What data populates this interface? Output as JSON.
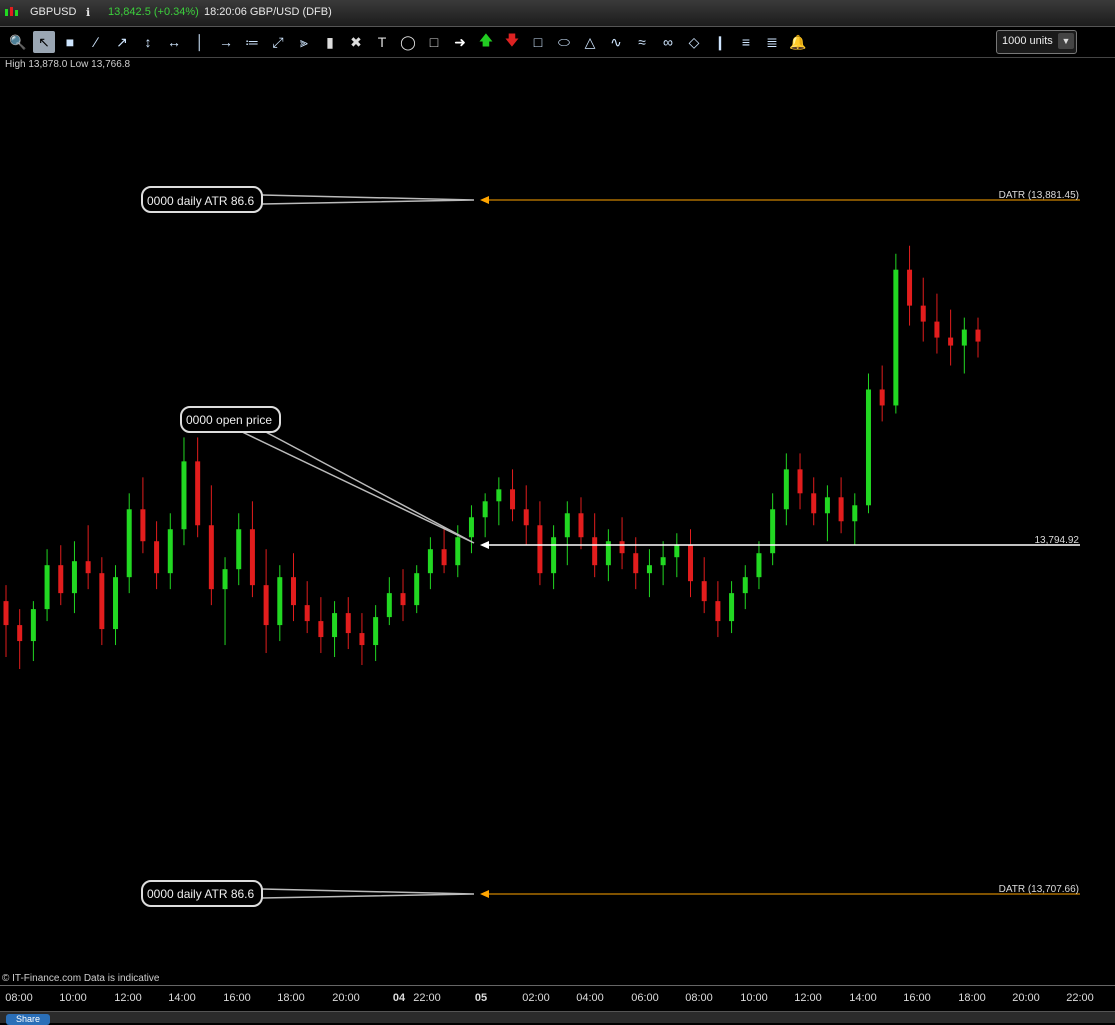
{
  "title_bar": {
    "symbol": "GBPUSD",
    "price_change": "13,842.5 (+0.34%)",
    "time_instrument": "18:20:06 GBP/USD (DFB)",
    "change_color": "#3ccf3c"
  },
  "toolbar": {
    "tools": [
      "magnifier-icon",
      "pointer-icon",
      "ruler-icon",
      "trendline-icon",
      "ray-icon",
      "vertical-line-icon",
      "channel-icon",
      "horizontal-line-icon",
      "horizontal-ray-icon",
      "parallel-channel-icon",
      "gann-icon",
      "pitchfork-icon",
      "delete-icon",
      "tools-icon",
      "text-icon",
      "callout-icon",
      "label-icon",
      "arrow-right-icon",
      "arrow-up-icon",
      "arrow-down-icon",
      "rectangle-icon",
      "ellipse-icon",
      "triangle-icon",
      "pattern-icon",
      "wave-icon",
      "cycles-icon",
      "diamond-icon",
      "fib-timezones-icon",
      "fib-retracement-icon",
      "fib-extension-icon",
      "alert-bell-icon"
    ],
    "units_value": "1000 units"
  },
  "chart_info": "High 13,878.0 Low 13,766.8",
  "annotations": {
    "upper_callout": "0000 daily ATR 86.6",
    "open_callout": "0000 open price",
    "lower_callout": "0000 daily ATR 86.6",
    "upper_line_label": "DATR (13,881.45)",
    "open_line_label": "13,794.92",
    "lower_line_label": "DATR (13,707.66)"
  },
  "footer_note": "© IT-Finance.com Data is indicative",
  "x_axis_ticks": [
    "08:00",
    "10:00",
    "12:00",
    "14:00",
    "16:00",
    "18:00",
    "20:00",
    "04",
    "22:00",
    "05",
    "02:00",
    "04:00",
    "06:00",
    "08:00",
    "10:00",
    "12:00",
    "14:00",
    "16:00",
    "18:00",
    "20:00",
    "22:00"
  ],
  "bottom_bar": {
    "share_label": "Share"
  },
  "colors": {
    "up": "#22d822",
    "down": "#e21d1d",
    "atr": "#ffa500",
    "open": "#ffffff"
  },
  "chart_data": {
    "type": "candlestick",
    "levels": {
      "atr_high": 13881.45,
      "open": 13794.92,
      "atr_low": 13707.66
    },
    "ylim": [
      13700,
      13900
    ],
    "ohlc": [
      [
        13781,
        13785,
        13767,
        13775
      ],
      [
        13775,
        13779,
        13764,
        13771
      ],
      [
        13771,
        13781,
        13766,
        13779
      ],
      [
        13779,
        13794,
        13776,
        13790
      ],
      [
        13790,
        13795,
        13780,
        13783
      ],
      [
        13783,
        13796,
        13778,
        13791
      ],
      [
        13791,
        13800,
        13784,
        13788
      ],
      [
        13788,
        13792,
        13770,
        13774
      ],
      [
        13774,
        13790,
        13770,
        13787
      ],
      [
        13787,
        13808,
        13783,
        13804
      ],
      [
        13804,
        13812,
        13793,
        13796
      ],
      [
        13796,
        13801,
        13784,
        13788
      ],
      [
        13788,
        13803,
        13784,
        13799
      ],
      [
        13799,
        13822,
        13795,
        13816
      ],
      [
        13816,
        13822,
        13797,
        13800
      ],
      [
        13800,
        13810,
        13780,
        13784
      ],
      [
        13784,
        13792,
        13770,
        13789
      ],
      [
        13789,
        13803,
        13785,
        13799
      ],
      [
        13799,
        13806,
        13782,
        13785
      ],
      [
        13785,
        13794,
        13768,
        13775
      ],
      [
        13775,
        13790,
        13771,
        13787
      ],
      [
        13787,
        13793,
        13776,
        13780
      ],
      [
        13780,
        13786,
        13773,
        13776
      ],
      [
        13776,
        13782,
        13768,
        13772
      ],
      [
        13772,
        13781,
        13767,
        13778
      ],
      [
        13778,
        13782,
        13769,
        13773
      ],
      [
        13773,
        13778,
        13765,
        13770
      ],
      [
        13770,
        13780,
        13766,
        13777
      ],
      [
        13777,
        13787,
        13775,
        13783
      ],
      [
        13783,
        13789,
        13776,
        13780
      ],
      [
        13780,
        13790,
        13778,
        13788
      ],
      [
        13788,
        13797,
        13784,
        13794
      ],
      [
        13794,
        13799,
        13788,
        13790
      ],
      [
        13790,
        13800,
        13787,
        13797
      ],
      [
        13797,
        13805,
        13793,
        13802
      ],
      [
        13802,
        13808,
        13797,
        13806
      ],
      [
        13806,
        13812,
        13800,
        13809
      ],
      [
        13809,
        13814,
        13801,
        13804
      ],
      [
        13804,
        13810,
        13795,
        13800
      ],
      [
        13800,
        13806,
        13785,
        13788
      ],
      [
        13788,
        13800,
        13784,
        13797
      ],
      [
        13797,
        13806,
        13790,
        13803
      ],
      [
        13803,
        13807,
        13794,
        13797
      ],
      [
        13797,
        13803,
        13787,
        13790
      ],
      [
        13790,
        13799,
        13786,
        13796
      ],
      [
        13796,
        13802,
        13789,
        13793
      ],
      [
        13793,
        13797,
        13784,
        13788
      ],
      [
        13788,
        13794,
        13782,
        13790
      ],
      [
        13790,
        13796,
        13785,
        13792
      ],
      [
        13792,
        13798,
        13787,
        13795
      ],
      [
        13795,
        13799,
        13782,
        13786
      ],
      [
        13786,
        13792,
        13778,
        13781
      ],
      [
        13781,
        13786,
        13772,
        13776
      ],
      [
        13776,
        13786,
        13773,
        13783
      ],
      [
        13783,
        13790,
        13779,
        13787
      ],
      [
        13787,
        13796,
        13784,
        13793
      ],
      [
        13793,
        13808,
        13790,
        13804
      ],
      [
        13804,
        13818,
        13800,
        13814
      ],
      [
        13814,
        13818,
        13804,
        13808
      ],
      [
        13808,
        13812,
        13800,
        13803
      ],
      [
        13803,
        13810,
        13796,
        13807
      ],
      [
        13807,
        13812,
        13798,
        13801
      ],
      [
        13801,
        13808,
        13795,
        13805
      ],
      [
        13805,
        13838,
        13803,
        13834
      ],
      [
        13834,
        13840,
        13826,
        13830
      ],
      [
        13830,
        13868,
        13828,
        13864
      ],
      [
        13864,
        13870,
        13850,
        13855
      ],
      [
        13855,
        13862,
        13846,
        13851
      ],
      [
        13851,
        13858,
        13843,
        13847
      ],
      [
        13847,
        13854,
        13840,
        13845
      ],
      [
        13845,
        13852,
        13838,
        13849
      ],
      [
        13849,
        13852,
        13842,
        13846
      ]
    ]
  }
}
